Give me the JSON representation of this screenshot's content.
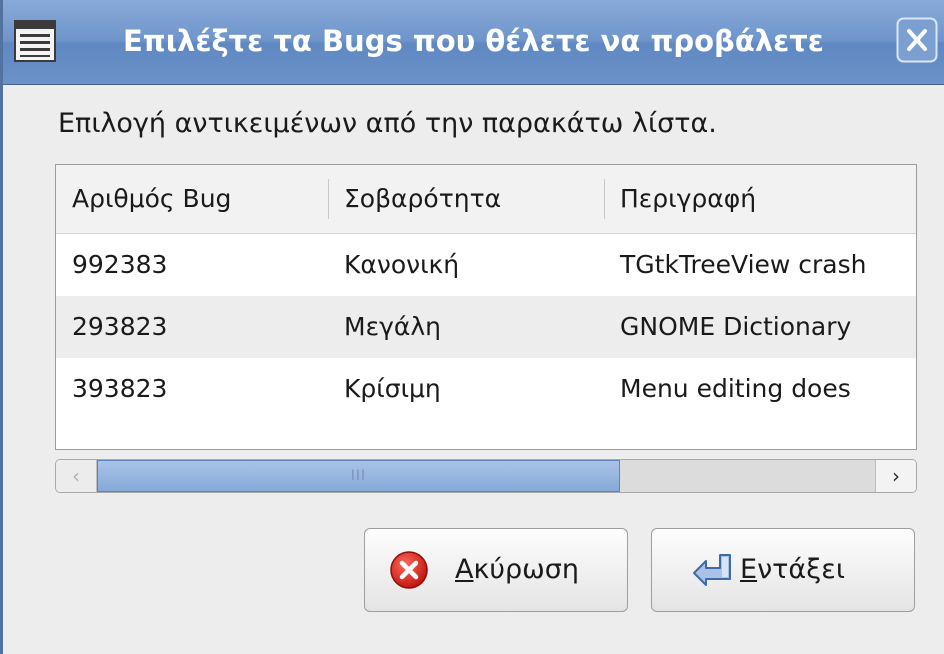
{
  "window": {
    "title": "Επιλέξτε τα Bugs που θέλετε να προβάλετε",
    "menu_icon": "window-menu-icon",
    "close_icon": "close-icon"
  },
  "prompt": "Επιλογή αντικειμένων από την παρακάτω λίστα.",
  "list": {
    "columns": [
      "Αριθμός Bug",
      "Σοβαρότητα",
      "Περιγραφή"
    ],
    "rows": [
      [
        "992383",
        "Κανονική",
        "TGtkTreeView crash"
      ],
      [
        "293823",
        "Μεγάλη",
        "GNOME Dictionary"
      ],
      [
        "393823",
        "Κρίσιμη",
        "Menu editing does"
      ]
    ]
  },
  "scrollbar": {
    "left_arrow": "‹",
    "thumb_grip": "III",
    "right_arrow": "›",
    "thumb_fraction": 0.63
  },
  "buttons": {
    "cancel": {
      "mnemonic": "Α",
      "rest": "κύρωση",
      "icon": "cancel-icon"
    },
    "ok": {
      "mnemonic": "Ε",
      "rest": "ντάξει",
      "icon": "ok-arrow-icon"
    }
  },
  "colors": {
    "titlebar": "#6f95cb",
    "selection": "#86a9d9",
    "cancel_red": "#d8261c"
  }
}
